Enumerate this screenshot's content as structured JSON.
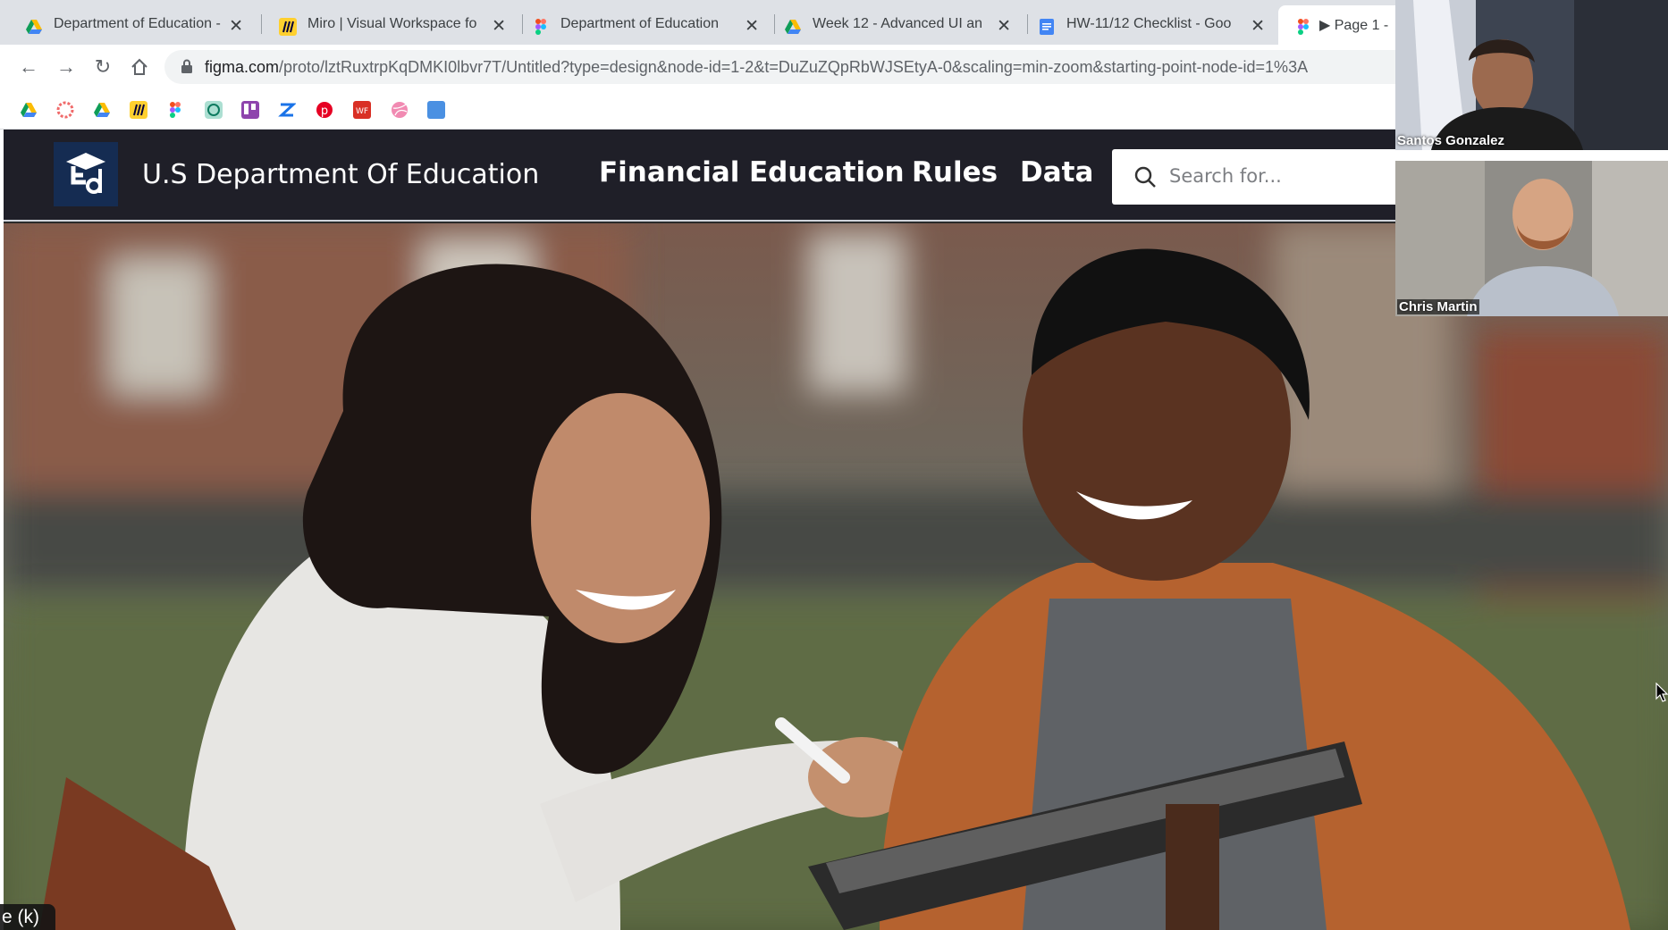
{
  "browser": {
    "tabs": [
      {
        "title": "Department of Education -",
        "icon": "google-drive-icon"
      },
      {
        "title": "Miro | Visual Workspace fo",
        "icon": "miro-icon"
      },
      {
        "title": "Department of Education",
        "icon": "figma-icon"
      },
      {
        "title": "Week 12 - Advanced UI an",
        "icon": "google-drive-icon"
      },
      {
        "title": "HW-11/12 Checklist - Goo",
        "icon": "google-docs-icon"
      },
      {
        "title": "▶ Page 1 -",
        "icon": "figma-icon"
      }
    ],
    "url_host": "figma.com",
    "url_path": "/proto/lztRuxtrpKqDMKI0lbvr7T/Untitled?type=design&node-id=1-2&t=DuZuZQpRbWJSEtyA-0&scaling=min-zoom&starting-point-node-id=1%3A"
  },
  "site": {
    "title": "U.S Department Of Education",
    "nav": [
      "Financial",
      "Education",
      "Rules",
      "Data"
    ],
    "search_placeholder": "Search for..."
  },
  "call": {
    "participants": [
      "Santos Gonzalez",
      "Chris Martin"
    ]
  },
  "overlay": {
    "shortcut_label": "e (k)"
  },
  "colors": {
    "header_bg": "#1f1f28",
    "logo_bg": "#152c52",
    "tab_strip": "#dee1e6"
  }
}
